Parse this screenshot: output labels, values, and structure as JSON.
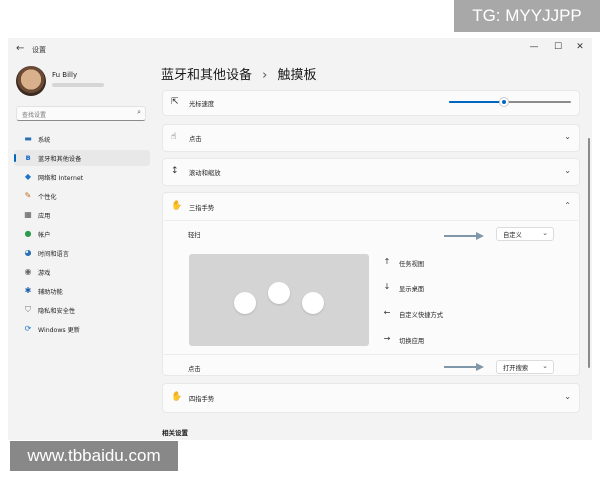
{
  "watermarks": {
    "top": "TG: MYYJJPP",
    "bottom": "www.tbbaidu.com"
  },
  "titlebar": {
    "title": "设置",
    "back_icon": "back-arrow-icon",
    "controls": [
      "—",
      "☐",
      "✕"
    ]
  },
  "profile": {
    "name": "Fu Billy"
  },
  "search": {
    "placeholder": "查找设置"
  },
  "sidebar": {
    "items": [
      {
        "label": "系统",
        "icon": "monitor-icon",
        "active": false
      },
      {
        "label": "蓝牙和其他设备",
        "icon": "bluetooth-icon",
        "active": true
      },
      {
        "label": "网络和 Internet",
        "icon": "wifi-icon",
        "active": false
      },
      {
        "label": "个性化",
        "icon": "brush-icon",
        "active": false
      },
      {
        "label": "应用",
        "icon": "apps-icon",
        "active": false
      },
      {
        "label": "帐户",
        "icon": "person-icon",
        "active": false
      },
      {
        "label": "时间和语言",
        "icon": "globe-clock-icon",
        "active": false
      },
      {
        "label": "游戏",
        "icon": "gamepad-icon",
        "active": false
      },
      {
        "label": "辅助功能",
        "icon": "accessibility-icon",
        "active": false
      },
      {
        "label": "隐私和安全性",
        "icon": "shield-icon",
        "active": false
      },
      {
        "label": "Windows 更新",
        "icon": "update-icon",
        "active": false
      }
    ]
  },
  "header": {
    "breadcrumb_parent": "蓝牙和其他设备",
    "separator": "›",
    "page_title": "触摸板"
  },
  "cards": {
    "cursor_speed": {
      "label": "光标速度",
      "slider_value": 0.45
    },
    "tap": {
      "label": "点击"
    },
    "scroll_zoom": {
      "label": "滚动和缩放"
    },
    "three_finger": {
      "label": "三指手势",
      "swipe_label": "轻扫",
      "swipe_value": "自定义",
      "gestures": [
        {
          "arrow": "↑",
          "label": "任务视图"
        },
        {
          "arrow": "↓",
          "label": "显示桌面"
        },
        {
          "arrow": "←",
          "label": "自定义快捷方式"
        },
        {
          "arrow": "→",
          "label": "切换应用"
        }
      ],
      "tap_label": "点击",
      "tap_value": "打开搜索"
    },
    "four_finger": {
      "label": "四指手势"
    }
  },
  "related": {
    "label": "相关设置"
  },
  "colors": {
    "accent": "#0067c0",
    "window_bg": "#f3f3f3",
    "card_bg": "#fbfbfb",
    "hint_arrow": "#7f97a8"
  }
}
